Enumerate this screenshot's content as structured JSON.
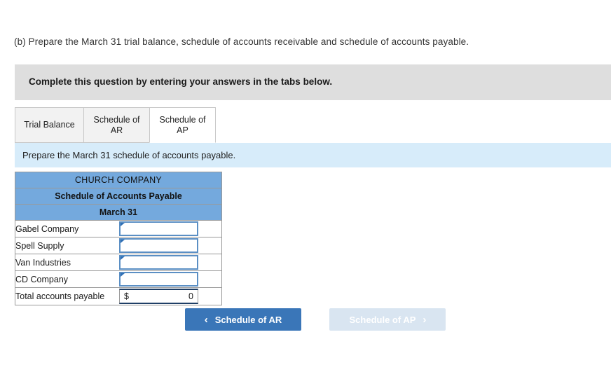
{
  "question": {
    "prompt": "(b) Prepare the March 31 trial balance, schedule of accounts receivable and schedule of accounts payable."
  },
  "banner": {
    "text": "Complete this question by entering your answers in the tabs below."
  },
  "tabs": [
    {
      "label": "Trial Balance",
      "active": false
    },
    {
      "label": "Schedule of AR",
      "active": false
    },
    {
      "label": "Schedule of AP",
      "active": true
    }
  ],
  "subinstruction": {
    "text": "Prepare the March 31 schedule of accounts payable."
  },
  "worksheet": {
    "title_company": "CHURCH COMPANY",
    "title_schedule": "Schedule of Accounts Payable",
    "title_date": "March 31",
    "rows": [
      {
        "label": "Gabel Company",
        "value": ""
      },
      {
        "label": "Spell Supply",
        "value": ""
      },
      {
        "label": "Van Industries",
        "value": ""
      },
      {
        "label": "CD Company",
        "value": ""
      }
    ],
    "total": {
      "label": "Total accounts payable",
      "currency": "$",
      "value": "0"
    }
  },
  "nav": {
    "prev_label": "Schedule of AR",
    "prev_icon": "chevron-left-icon",
    "prev_glyph": "‹",
    "next_label": "Schedule of AP",
    "next_icon": "chevron-right-icon",
    "next_glyph": "›"
  },
  "colors": {
    "banner_bg": "#dedede",
    "subinstruction_bg": "#d7ecfa",
    "table_header_bg": "#74a9dd",
    "input_border": "#5b8fc4",
    "primary_button": "#3a76b8",
    "disabled_button": "#d9e5f1"
  }
}
